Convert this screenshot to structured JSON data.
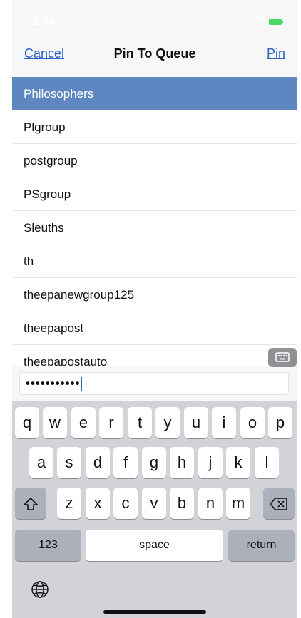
{
  "status_bar": {
    "time": "2:54"
  },
  "nav": {
    "cancel_label": "Cancel",
    "title": "Pin To Queue",
    "pin_label": "Pin"
  },
  "groups": [
    {
      "label": "Philosophers",
      "selected": true
    },
    {
      "label": "Plgroup"
    },
    {
      "label": "postgroup"
    },
    {
      "label": "PSgroup"
    },
    {
      "label": "Sleuths"
    },
    {
      "label": "th"
    },
    {
      "label": "theepanewgroup125"
    },
    {
      "label": "theepapost"
    },
    {
      "label": "theepapostauto"
    }
  ],
  "password_field": {
    "value": "•••••••••••"
  },
  "keyboard": {
    "row1": [
      "q",
      "w",
      "e",
      "r",
      "t",
      "y",
      "u",
      "i",
      "o",
      "p"
    ],
    "row2": [
      "a",
      "s",
      "d",
      "f",
      "g",
      "h",
      "j",
      "k",
      "l"
    ],
    "row3": [
      "z",
      "x",
      "c",
      "v",
      "b",
      "n",
      "m"
    ],
    "numbers_label": "123",
    "space_label": "space",
    "return_label": "return",
    "shift_icon": "shift-icon",
    "backspace_icon": "backspace-icon",
    "globe_icon": "globe-icon"
  },
  "colors": {
    "accent": "#2d62c4",
    "selected_row": "#5e86c1",
    "keyboard_bg": "#d1d3d9"
  }
}
